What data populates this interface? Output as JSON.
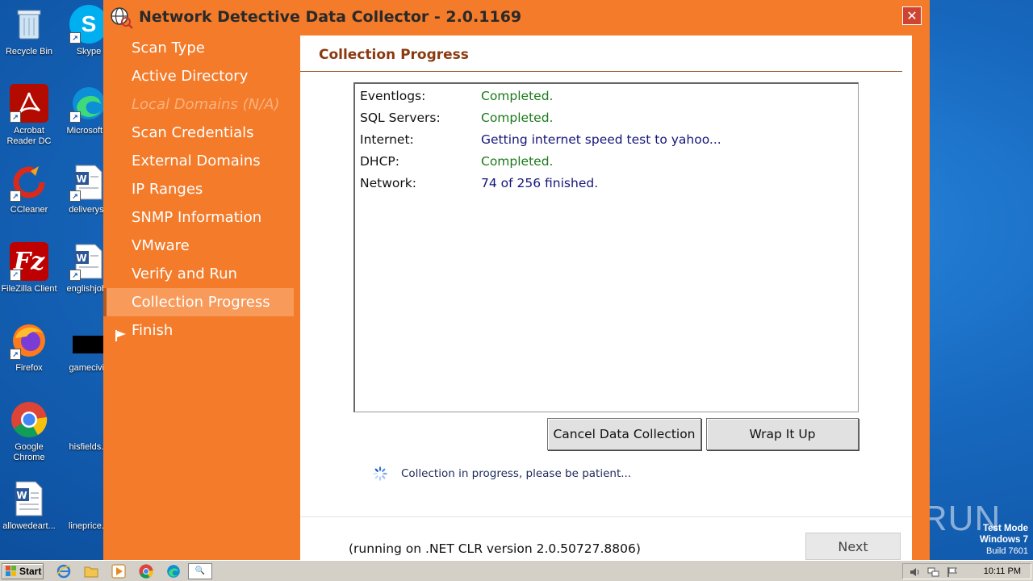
{
  "desktop": {
    "icons": [
      {
        "label": "Recycle Bin",
        "icon": "recycle-bin-icon"
      },
      {
        "label": "Skype",
        "icon": "skype-icon"
      },
      {
        "label": "Acrobat Reader DC",
        "icon": "acrobat-icon"
      },
      {
        "label": "Microsoft E",
        "icon": "edge-icon"
      },
      {
        "label": "CCleaner",
        "icon": "ccleaner-icon"
      },
      {
        "label": "deliveryse",
        "icon": "word-doc-icon"
      },
      {
        "label": "FileZilla Client",
        "icon": "filezilla-icon"
      },
      {
        "label": "englishjobs",
        "icon": "word-doc-icon"
      },
      {
        "label": "Firefox",
        "icon": "firefox-icon"
      },
      {
        "label": "gamecivil.",
        "icon": "black-file-icon"
      },
      {
        "label": "Google Chrome",
        "icon": "chrome-icon"
      },
      {
        "label": "hisfields.p",
        "icon": "blank-file-icon"
      },
      {
        "label": "allowedeart...",
        "icon": "word-doc-icon"
      },
      {
        "label": "lineprice.p",
        "icon": "blank-file-icon"
      }
    ]
  },
  "window": {
    "title": "Network Detective Data Collector - 2.0.1169",
    "close_label": "✕"
  },
  "nav": {
    "items": [
      {
        "label": "Scan Type"
      },
      {
        "label": "Active Directory"
      },
      {
        "label": "Local Domains (N/A)"
      },
      {
        "label": "Scan Credentials"
      },
      {
        "label": "External Domains"
      },
      {
        "label": "IP Ranges"
      },
      {
        "label": "SNMP Information"
      },
      {
        "label": "VMware"
      },
      {
        "label": "Verify and Run"
      },
      {
        "label": "Collection Progress"
      },
      {
        "label": "Finish"
      }
    ]
  },
  "content": {
    "title": "Collection Progress",
    "status": [
      {
        "key": "Eventlogs:",
        "value": "Completed."
      },
      {
        "key": "SQL Servers:",
        "value": "Completed."
      },
      {
        "key": "Internet:",
        "value": "Getting internet speed test to yahoo..."
      },
      {
        "key": "DHCP:",
        "value": "Completed."
      },
      {
        "key": "Network:",
        "value": "74 of 256 finished."
      }
    ],
    "cancel_label": "Cancel Data Collection",
    "wrap_label": "Wrap It Up",
    "progress_message": "Collection in progress, please be patient...",
    "clr_text": "(running on .NET CLR version 2.0.50727.8806)",
    "next_label": "Next"
  },
  "watermark": "ANY RUN",
  "test_mode": {
    "line1": "Test Mode",
    "line2": "Windows 7",
    "line3": "Build 7601"
  },
  "taskbar": {
    "start_label": "Start",
    "clock": "10:11 PM"
  },
  "colors": {
    "accent": "#f47b2a",
    "status_done": "#1a7a1a",
    "status_working": "#15157a"
  }
}
